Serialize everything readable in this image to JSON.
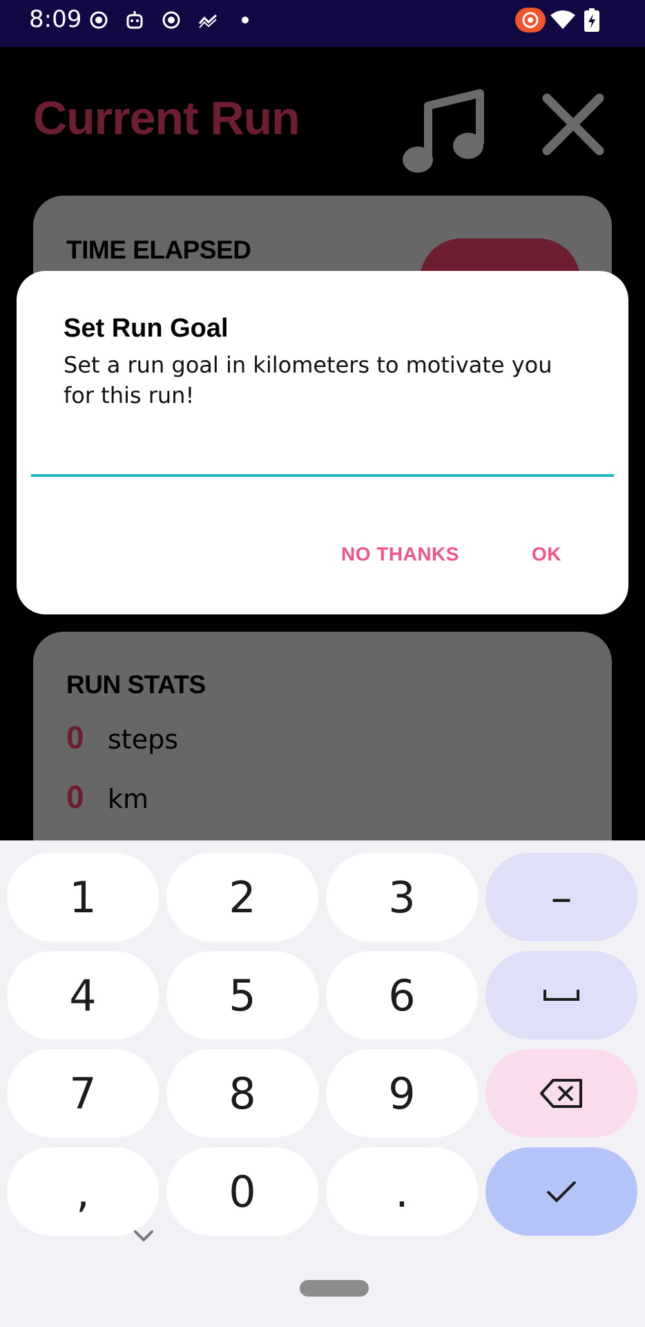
{
  "status_bar": {
    "time": "8:09",
    "icons": [
      "record-icon",
      "robot-icon",
      "record-icon",
      "analytics-icon",
      "dot-icon",
      "screen-record-icon",
      "wifi-icon",
      "battery-charging-icon"
    ]
  },
  "app": {
    "title": "Current Run",
    "title_color": "#6d1f31",
    "music_icon": "music-note-icon",
    "close_icon": "close-icon",
    "time_card": {
      "heading": "TIME ELAPSED"
    },
    "stats_card": {
      "heading": "RUN STATS",
      "stats": [
        {
          "value": "0",
          "unit": "steps"
        },
        {
          "value": "0",
          "unit": "km"
        }
      ]
    }
  },
  "dialog": {
    "title": "Set Run Goal",
    "message": "Set a run goal in kilometers to motivate you for this run!",
    "input_value": "",
    "accent_color": "#1ab8c4",
    "negative_label": "NO THANKS",
    "positive_label": "OK",
    "button_color": "#f25489"
  },
  "keyboard": {
    "rows": [
      [
        "1",
        "2",
        "3",
        "–"
      ],
      [
        "4",
        "5",
        "6",
        "space"
      ],
      [
        "7",
        "8",
        "9",
        "backspace"
      ],
      [
        ",",
        "0",
        ".",
        "enter"
      ]
    ],
    "keys": {
      "k1": "1",
      "k2": "2",
      "k3": "3",
      "dash": "–",
      "k4": "4",
      "k5": "5",
      "k6": "6",
      "k7": "7",
      "k8": "8",
      "k9": "9",
      "comma": ",",
      "k0": "0",
      "period": "."
    }
  }
}
